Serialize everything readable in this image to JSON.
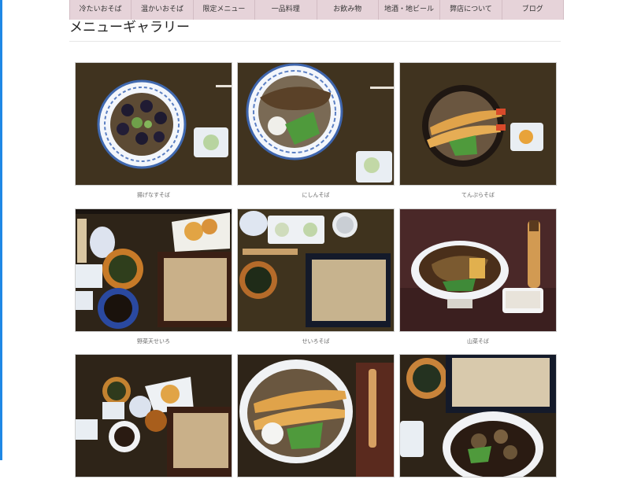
{
  "nav": {
    "items": [
      "冷たいおそば",
      "温かいおそば",
      "限定メニュー",
      "一品料理",
      "お飲み物",
      "地酒・地ビール",
      "弊店について",
      "ブログ"
    ]
  },
  "page": {
    "title": "メニューギャラリー"
  },
  "gallery": {
    "items": [
      {
        "caption": "揚げなすそば"
      },
      {
        "caption": "にしんそば"
      },
      {
        "caption": "てんぷらそば"
      },
      {
        "caption": "野菜天せいろ"
      },
      {
        "caption": "せいろそば"
      },
      {
        "caption": "山菜そば"
      },
      {
        "caption": ""
      },
      {
        "caption": ""
      },
      {
        "caption": ""
      }
    ]
  },
  "colors": {
    "nav_background": "#e6d3d9",
    "table_dark": "#2b2219",
    "accent_edge": "#1e88e5"
  }
}
